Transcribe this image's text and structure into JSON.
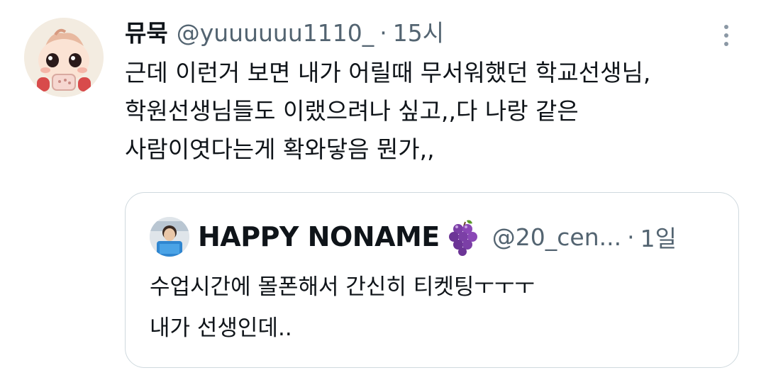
{
  "tweet": {
    "author": {
      "display_name": "뮤묵",
      "handle": "@yuuuuuu1110_",
      "avatar_icon": "baby-cartoon-avatar"
    },
    "separator": "·",
    "time": "15시",
    "more_icon": "more-vertical-icon",
    "text_lines": [
      "근데 이런거 보면 내가 어릴때 무서워했던 학교선생님,",
      "학원선생님들도 이랬으려나 싶고,,다 나랑 같은",
      "사람이엿다는게 확와닿음 뭔가,,"
    ]
  },
  "quote": {
    "author": {
      "display_name": "HAPPY NONAME",
      "emoji_icon": "grape-icon",
      "handle": "@20_cen...",
      "avatar_icon": "person-photo-avatar"
    },
    "separator": "·",
    "time": "1일",
    "text_lines": [
      "수업시간에 몰폰해서 간신히 티켓팅ㅜㅜㅜ",
      "내가 선생인데.."
    ]
  },
  "colors": {
    "text_primary": "#0f1419",
    "text_secondary": "#536471",
    "border": "#cfd9de",
    "background": "#ffffff"
  }
}
